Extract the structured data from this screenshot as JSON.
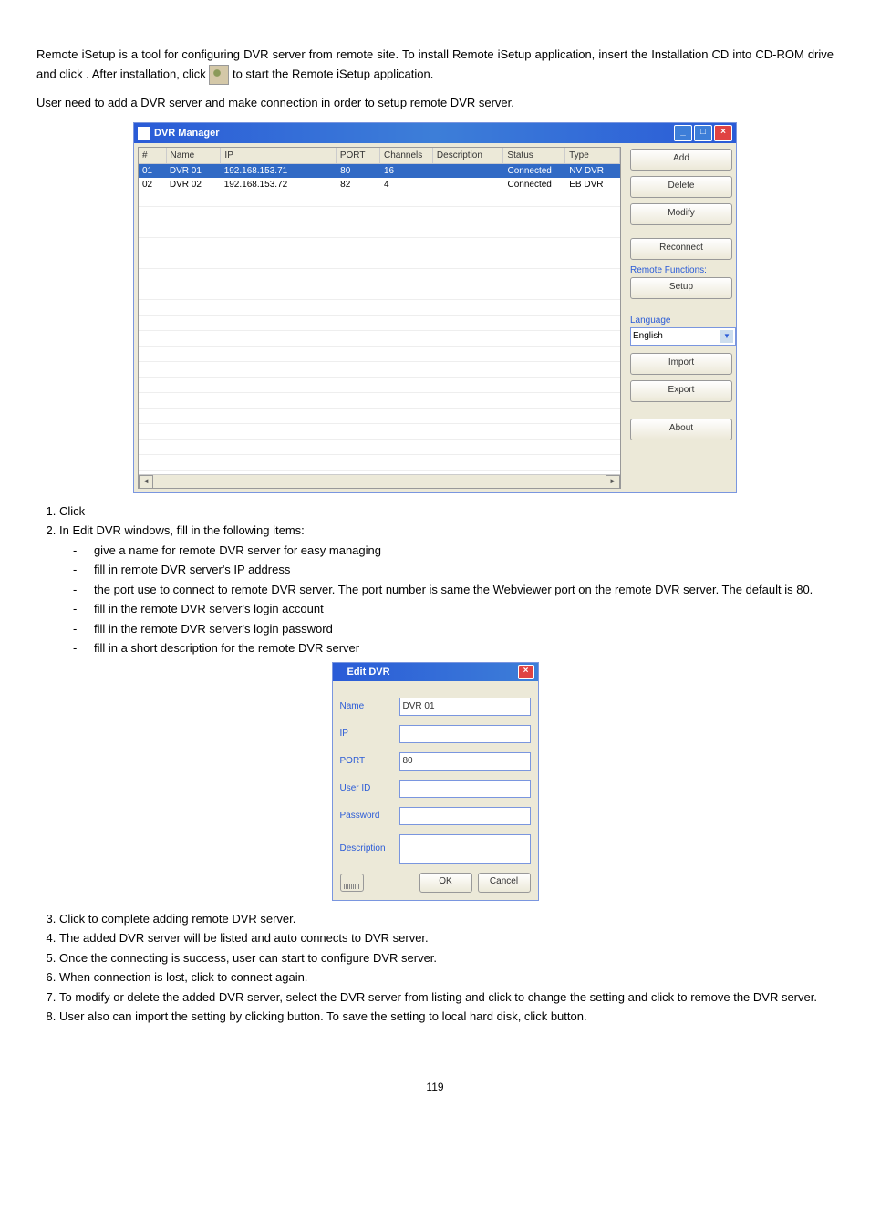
{
  "intro": {
    "p1a": "Remote iSetup is a tool for configuring DVR server from remote site. To install Remote iSetup application, insert the Installation CD into CD-ROM drive and click ",
    "p1b": ". After installation, click ",
    "p1c": " to start the Remote iSetup application.",
    "p2": "User need to add a DVR server and make connection in order to setup remote DVR server."
  },
  "dvr_manager": {
    "title": "DVR Manager",
    "columns": {
      "num": "#",
      "name": "Name",
      "ip": "IP",
      "port": "PORT",
      "channels": "Channels",
      "description": "Description",
      "status": "Status",
      "type": "Type"
    },
    "rows": [
      {
        "num": "01",
        "name": "DVR 01",
        "ip": "192.168.153.71",
        "port": "80",
        "channels": "16",
        "description": "",
        "status": "Connected",
        "type": "NV DVR"
      },
      {
        "num": "02",
        "name": "DVR 02",
        "ip": "192.168.153.72",
        "port": "82",
        "channels": "4",
        "description": "",
        "status": "Connected",
        "type": "EB DVR"
      }
    ],
    "buttons": {
      "add": "Add",
      "delete": "Delete",
      "modify": "Modify",
      "reconnect": "Reconnect",
      "setup": "Setup",
      "import": "Import",
      "export": "Export",
      "about": "About"
    },
    "labels": {
      "remote_functions": "Remote Functions:",
      "language": "Language"
    },
    "language_value": "English"
  },
  "steps": {
    "s1": "Click",
    "s2": "In Edit DVR windows, fill in the following items:",
    "s2_items": {
      "name": "give a name for remote DVR server for easy managing",
      "ip": "fill in remote DVR server's IP address",
      "port": "the port use to connect to remote DVR server. The port number is same the Webviewer port on the remote DVR server. The default is 80.",
      "user": "fill in the remote DVR server's login account",
      "password": "fill in the remote DVR server's login password",
      "description": "fill in a short description for the remote DVR server"
    },
    "s3a": "Click ",
    "s3b": " to complete adding remote DVR server.",
    "s4": "The added DVR server will be listed and auto connects to DVR server.",
    "s5": "Once the connecting is success, user can start to configure DVR server.",
    "s6a": "When connection is lost, click ",
    "s6b": " to connect again.",
    "s7a": "To modify or delete the added DVR server, select the DVR server from listing and click ",
    "s7b": " to change the setting and click ",
    "s7c": " to remove the DVR server.",
    "s8a": "User also can import the setting by clicking ",
    "s8b": " button. To save the setting to local hard disk, click ",
    "s8c": " button."
  },
  "edit_dvr": {
    "title": "Edit DVR",
    "labels": {
      "name": "Name",
      "ip": "IP",
      "port": "PORT",
      "user": "User ID",
      "password": "Password",
      "description": "Description"
    },
    "values": {
      "name": "DVR 01",
      "port": "80"
    },
    "buttons": {
      "ok": "OK",
      "cancel": "Cancel"
    }
  },
  "footer": "119"
}
